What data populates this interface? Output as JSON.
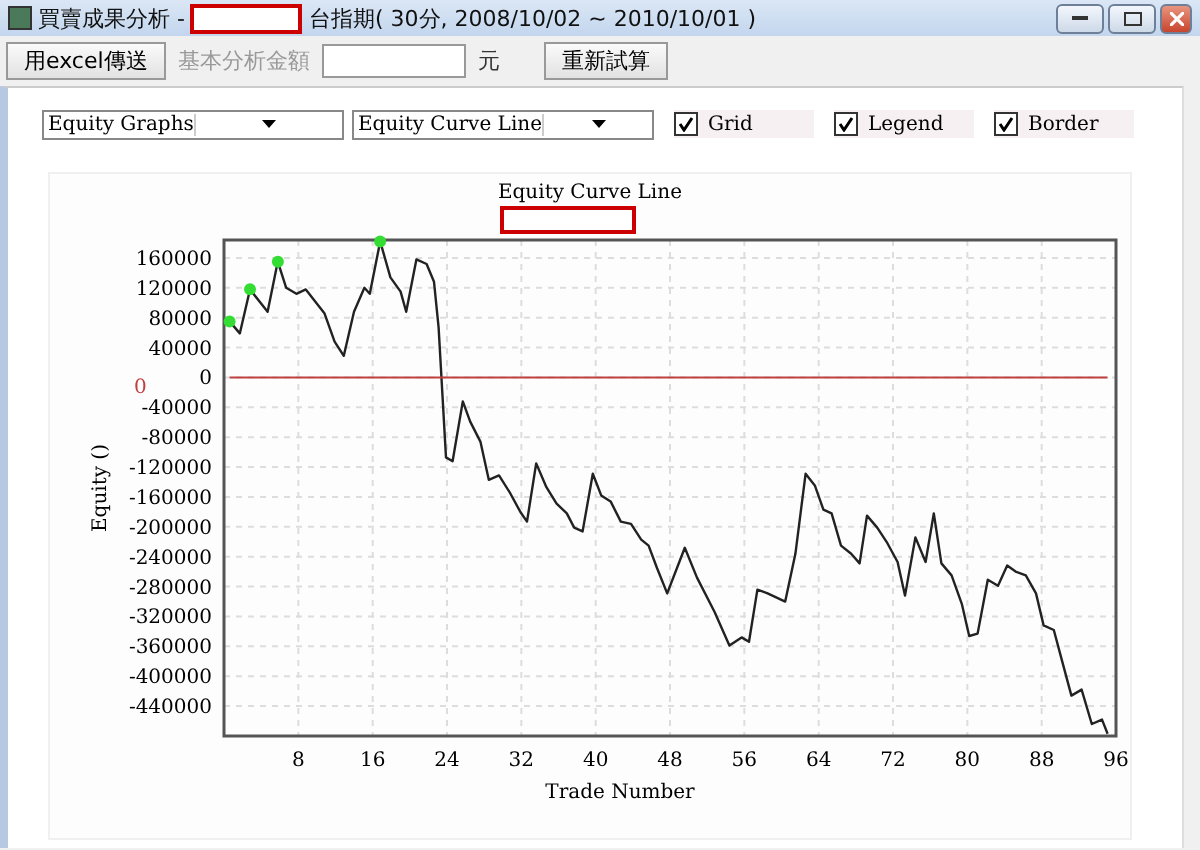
{
  "window": {
    "title": "買賣成果分析 -",
    "title_redacted": true,
    "title_suffix": "台指期( 30分, 2008/10/02 ~ 2010/10/01 )"
  },
  "toolbar": {
    "export_button": "用excel傳送",
    "amount_label": "基本分析金額",
    "amount_disabled": true,
    "amount_unit": "元",
    "recalc_button": "重新試算"
  },
  "controls": {
    "graph_type": "Equity Graphs",
    "graph_style": "Equity Curve Line",
    "checkboxes": [
      {
        "label": "Grid",
        "checked": true
      },
      {
        "label": "Legend",
        "checked": true
      },
      {
        "label": "Border",
        "checked": true
      }
    ]
  },
  "chart": {
    "subtitle_redacted": true,
    "chart_data": {
      "type": "line",
      "title": "Equity Curve Line",
      "xlabel": "Trade Number",
      "ylabel": "Equity ()",
      "grid": true,
      "xlim": [
        0,
        96
      ],
      "ylim": [
        -480000,
        184000
      ],
      "xticks": [
        8,
        16,
        24,
        32,
        40,
        48,
        56,
        64,
        72,
        80,
        88,
        96
      ],
      "yticks": [
        160000,
        120000,
        80000,
        40000,
        0,
        -40000,
        -80000,
        -120000,
        -160000,
        -200000,
        -240000,
        -280000,
        -320000,
        -360000,
        -400000,
        -440000
      ],
      "x": [
        0.6,
        1.7,
        2.8,
        4.7,
        5.8,
        6.7,
        7.8,
        8.8,
        10.8,
        11.9,
        12.9,
        14.0,
        15.1,
        15.7,
        16.8,
        17.9,
        19.0,
        19.6,
        20.7,
        21.8,
        22.6,
        23.1,
        23.9,
        24.6,
        25.7,
        26.5,
        27.6,
        28.5,
        29.6,
        30.8,
        31.9,
        32.6,
        33.6,
        34.7,
        35.8,
        36.9,
        37.7,
        38.6,
        39.7,
        40.6,
        41.6,
        42.7,
        43.8,
        44.9,
        45.7,
        46.6,
        47.7,
        49.6,
        50.9,
        52.8,
        54.4,
        55.7,
        56.5,
        57.4,
        58.5,
        60.4,
        61.5,
        62.6,
        63.6,
        64.5,
        65.4,
        66.4,
        67.5,
        68.4,
        69.2,
        70.3,
        71.4,
        72.5,
        73.3,
        74.4,
        75.5,
        76.4,
        77.2,
        78.3,
        79.4,
        80.2,
        81.1,
        82.2,
        83.3,
        84.3,
        85.2,
        86.3,
        87.4,
        88.2,
        89.3,
        90.2,
        91.2,
        92.3,
        93.4,
        94.5,
        95.1
      ],
      "series": [
        {
          "color": "#222222",
          "values": [
            75000,
            59000,
            118000,
            88000,
            155000,
            120000,
            112000,
            118000,
            86000,
            48000,
            29000,
            88000,
            120000,
            112000,
            182000,
            134000,
            115000,
            88000,
            158000,
            152000,
            128000,
            67000,
            -107000,
            -112000,
            -32000,
            -59000,
            -86000,
            -137000,
            -131000,
            -155000,
            -180000,
            -193000,
            -115000,
            -147000,
            -169000,
            -182000,
            -201000,
            -206000,
            -129000,
            -158000,
            -166000,
            -193000,
            -196000,
            -217000,
            -225000,
            -255000,
            -289000,
            -228000,
            -268000,
            -314000,
            -359000,
            -348000,
            -354000,
            -284000,
            -289000,
            -300000,
            -236000,
            -129000,
            -145000,
            -177000,
            -182000,
            -225000,
            -236000,
            -249000,
            -185000,
            -201000,
            -222000,
            -247000,
            -292000,
            -214000,
            -247000,
            -182000,
            -249000,
            -265000,
            -303000,
            -346000,
            -343000,
            -271000,
            -279000,
            -252000,
            -260000,
            -265000,
            -289000,
            -332000,
            -338000,
            -380000,
            -426000,
            -418000,
            -464000,
            -458000,
            -477000
          ]
        },
        {
          "name": "0",
          "color": "#c04040",
          "values": [
            0,
            0,
            0,
            0,
            0,
            0,
            0,
            0,
            0,
            0,
            0,
            0,
            0,
            0,
            0,
            0,
            0,
            0,
            0,
            0,
            0,
            0,
            0,
            0,
            0,
            0,
            0,
            0,
            0,
            0,
            0,
            0,
            0,
            0,
            0,
            0,
            0,
            0,
            0,
            0,
            0,
            0,
            0,
            0,
            0,
            0,
            0,
            0,
            0,
            0,
            0,
            0,
            0,
            0,
            0,
            0,
            0,
            0,
            0,
            0,
            0,
            0,
            0,
            0,
            0,
            0,
            0,
            0,
            0,
            0,
            0,
            0,
            0,
            0,
            0,
            0,
            0,
            0,
            0,
            0,
            0,
            0,
            0,
            0,
            0,
            0,
            0,
            0,
            0,
            0,
            0
          ]
        }
      ]
    }
  }
}
